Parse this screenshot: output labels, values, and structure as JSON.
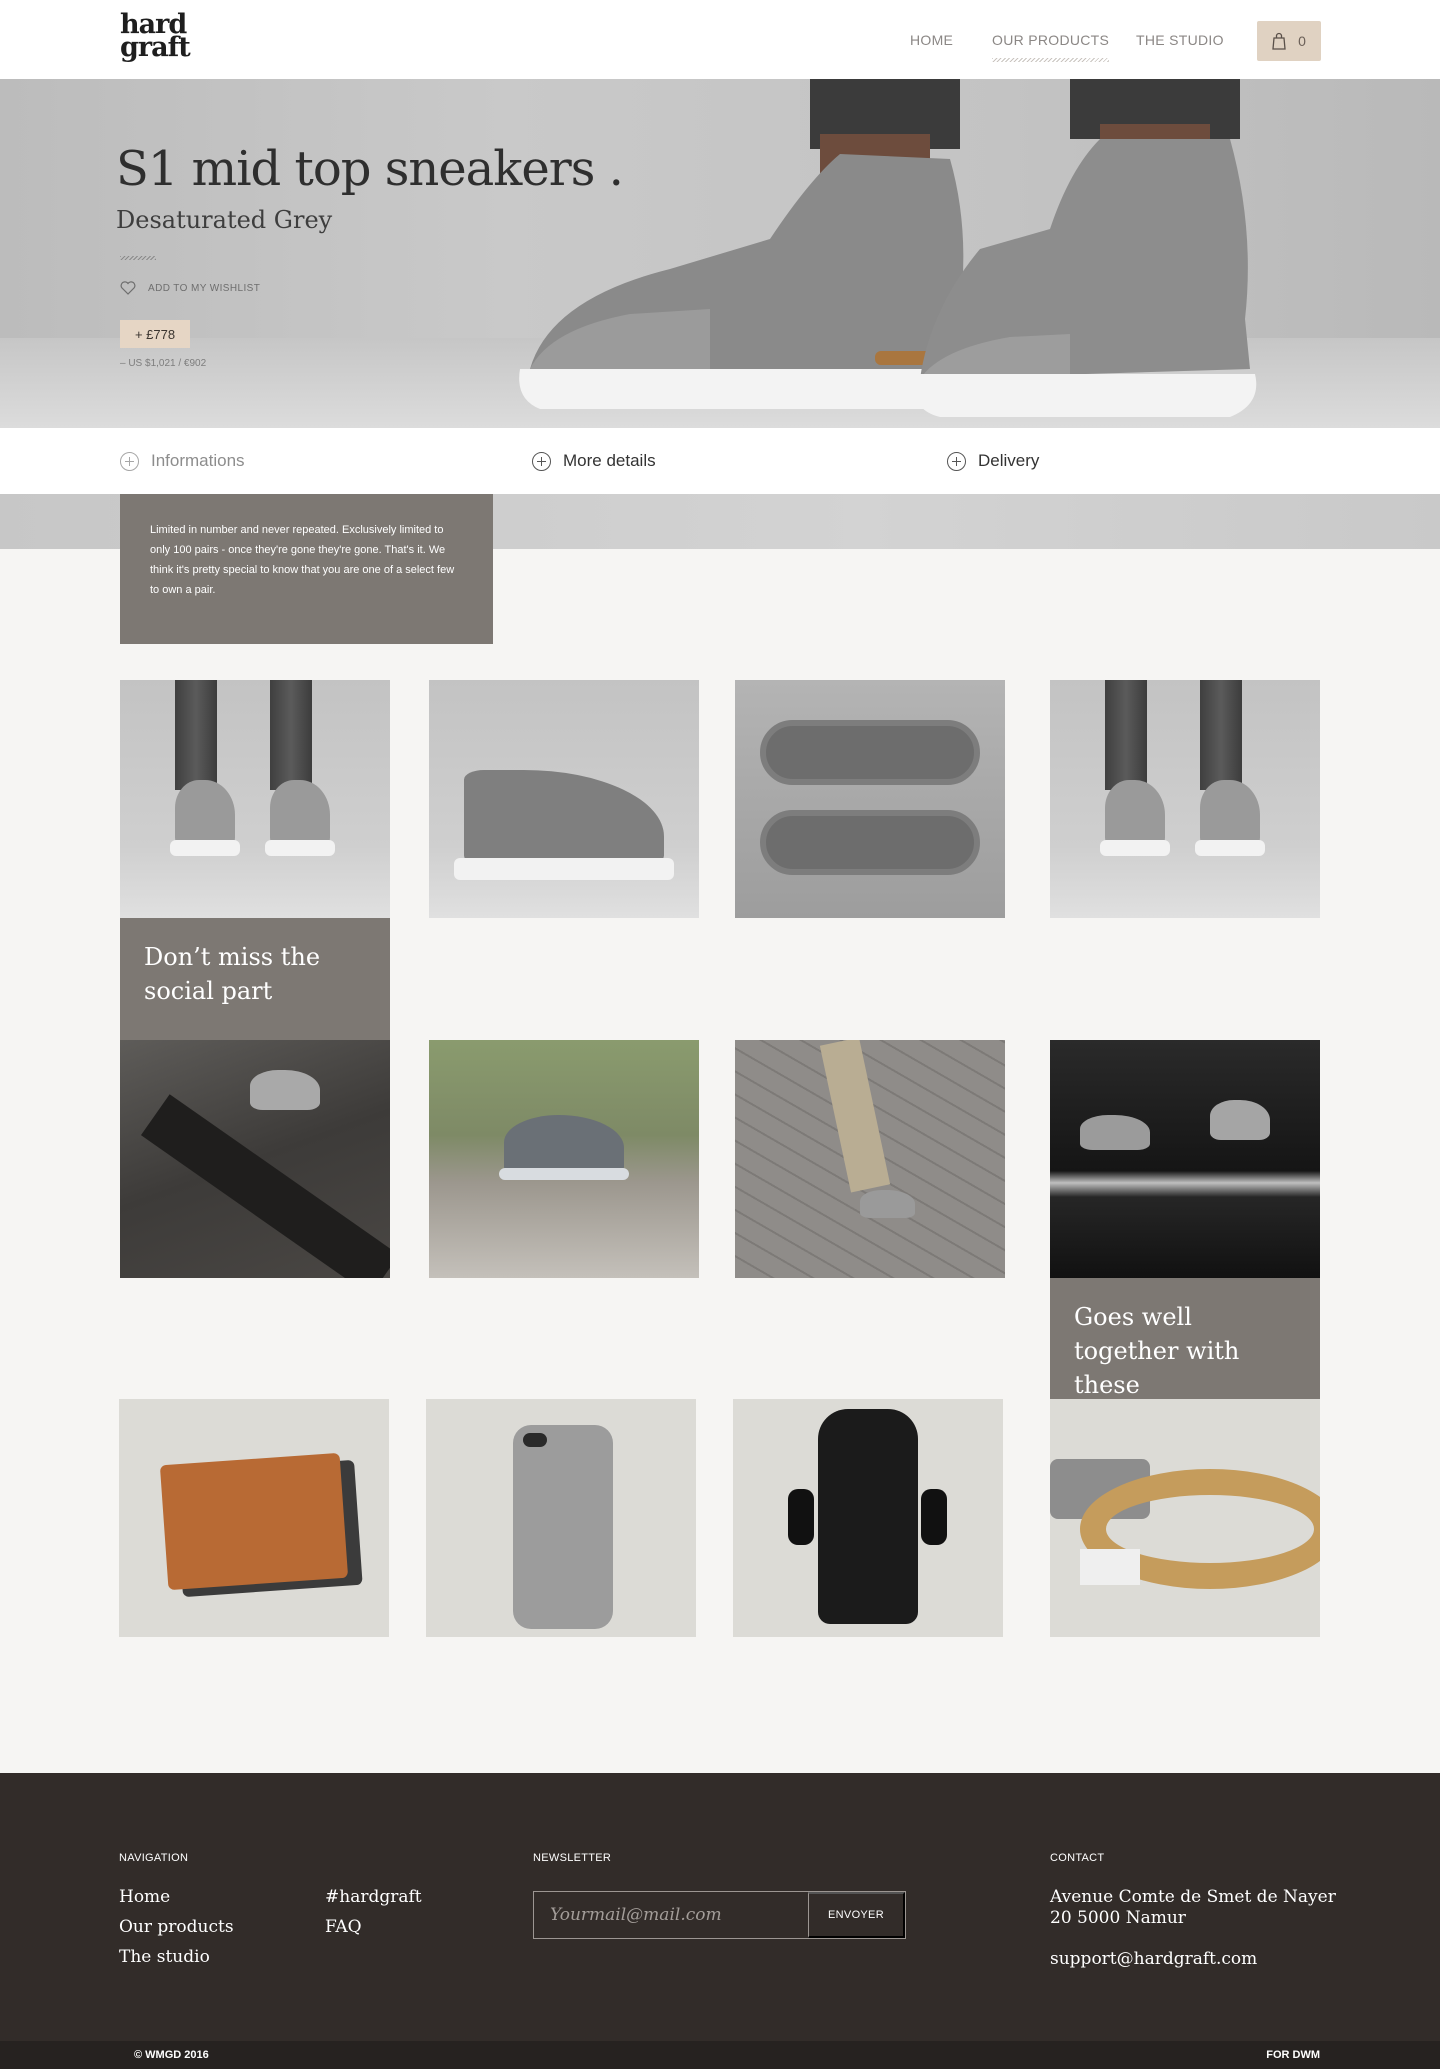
{
  "header": {
    "logo": "hard graft",
    "nav": [
      "HOME",
      "OUR PRODUCTS",
      "THE STUDIO"
    ],
    "cart_count": "0"
  },
  "hero": {
    "title": "S1 mid top sneakers .",
    "subtitle": "Desaturated Grey",
    "wishlist_label": "ADD TO MY WISHLIST",
    "price": "+ £778",
    "price_alt": "– US $1,021 / €902"
  },
  "info_tabs": [
    "Informations",
    "More details",
    "Delivery"
  ],
  "info_panel": {
    "text": "Limited in number and never repeated. Exclusively limited to only 100 pairs - once they're gone they're gone. That's it. We think it's pretty special to know that you are one of a select few to own a pair."
  },
  "social_caption": "Don’t miss the social part",
  "related_caption": "Goes well together with these",
  "footer": {
    "navigation_heading": "NAVIGATION",
    "nav_links": [
      "Home",
      "Our products",
      "The studio"
    ],
    "nav_links_2": [
      "#hardgraft",
      "FAQ"
    ],
    "newsletter_heading": "NEWSLETTER",
    "newsletter_placeholder": "Yourmail@mail.com",
    "newsletter_button": "ENVOYER",
    "contact_heading": "CONTACT",
    "address_line1": "Avenue Comte de Smet de Nayer",
    "address_line2": "20 5000 Namur",
    "email": "support@hardgraft.com",
    "copyright": "© WMGD 2016",
    "credit": "FOR DWM"
  },
  "colors": {
    "accent_badge": "#e0d2c2",
    "caption_bg": "#7d7873",
    "footer_bg": "#322c29"
  }
}
